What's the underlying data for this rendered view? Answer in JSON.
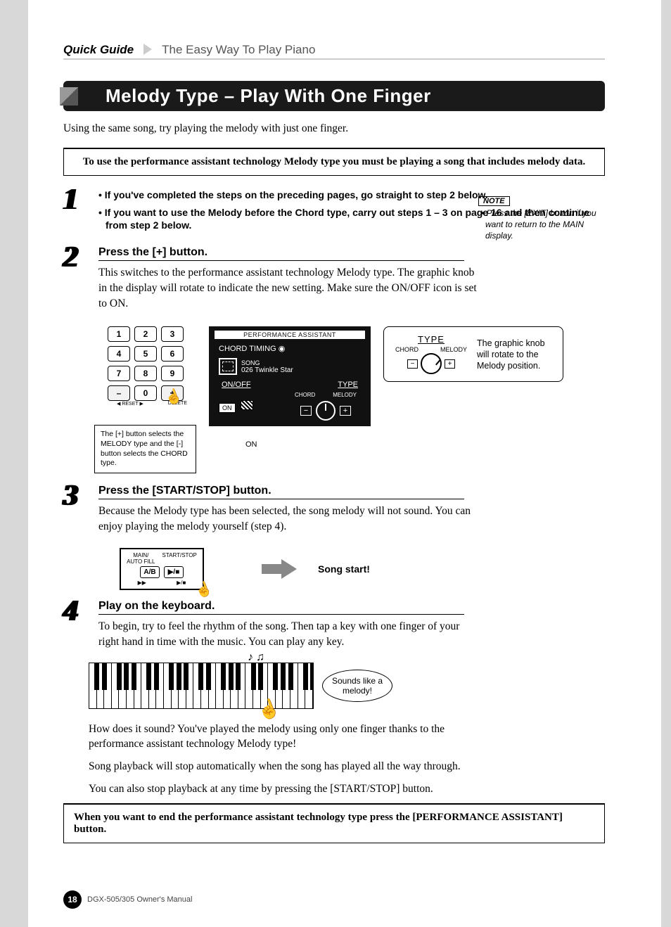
{
  "header": {
    "guide": "Quick Guide",
    "title": "The Easy Way To Play Piano"
  },
  "section": {
    "title": "Melody Type – Play With One Finger"
  },
  "intro": "Using the same song, try playing the melody with just one finger.",
  "rule": "To use the performance assistant technology Melody type you must be playing a song that includes melody data.",
  "step1": {
    "num": "1",
    "bullets": [
      "If you've completed the steps on the preceding pages, go straight to step 2 below.",
      "If you want to use the Melody before the Chord type, carry out steps 1 – 3 on page 16 and then continue from step 2 below."
    ]
  },
  "sidenote": {
    "label": "NOTE",
    "body": "• Press the [EXIT] button if you want to return to the MAIN display."
  },
  "step2": {
    "num": "2",
    "head": "Press the [+] button.",
    "body": "This switches to the performance assistant technology Melody type. The graphic knob in the display will rotate to indicate the new setting. Make sure the ON/OFF icon is set to ON.",
    "keypad": [
      "1",
      "2",
      "3",
      "4",
      "5",
      "6",
      "7",
      "8",
      "9",
      "–",
      "0",
      "+"
    ],
    "reset": "RESET",
    "delete": "DELETE",
    "keypad_caption": "The [+] button selects the MELODY type and the [-] button selects the CHORD type.",
    "lcd": {
      "bar": "PERFORMANCE ASSISTANT",
      "timing": "CHORD TIMING",
      "song_label": "SONG",
      "song_name": "026 Twinkle Star",
      "onoff": "ON/OFF",
      "type": "TYPE",
      "on": "ON",
      "chord": "CHORD",
      "melody": "MELODY"
    },
    "on_callout": "ON",
    "typebox": {
      "title": "TYPE",
      "chord": "CHORD",
      "melody": "MELODY",
      "text": "The graphic knob will rotate to the Melody position."
    }
  },
  "step3": {
    "num": "3",
    "head": "Press the [START/STOP] button.",
    "body": "Because the Melody type has been selected, the song melody will not sound. You can enjoy playing the melody yourself (step 4).",
    "btn": {
      "main": "MAIN/\nAUTO FILL",
      "ss": "START/STOP",
      "ab": "A/B",
      "play": "▶/■",
      "ff": "▶▶",
      "sub2": "▶/■"
    },
    "songstart": "Song start!"
  },
  "step4": {
    "num": "4",
    "head": "Play on the keyboard.",
    "p1": "To begin, try to feel the rhythm of the song. Then tap a key with one finger of your right hand in time with the music. You can play any key.",
    "bubble": "Sounds like a melody!",
    "notes": "♪  ♫",
    "p2": "How does it sound? You've played the melody using only one finger thanks to the performance assistant technology Melody type!",
    "p3": "Song playback will stop automatically when the song has played all the way through.",
    "p4": "You can also stop playback at any time by pressing the [START/STOP] button."
  },
  "endbox": "When you want to end the performance assistant technology type press the [PERFORMANCE ASSISTANT] button.",
  "footer": {
    "page": "18",
    "manual": "DGX-505/305  Owner's Manual"
  }
}
